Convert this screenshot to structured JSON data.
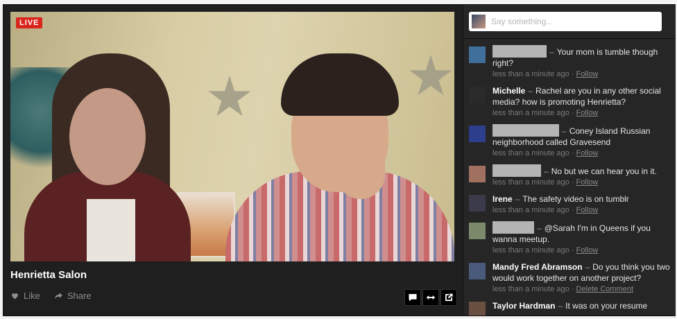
{
  "stream": {
    "live_label": "LIVE",
    "title": "Henrietta Salon",
    "like_label": "Like",
    "share_label": "Share"
  },
  "chat": {
    "placeholder": "Say something...",
    "comments": [
      {
        "name": "",
        "redacted": true,
        "text": "Your mom is tumble though right?",
        "time": "less than a minute ago",
        "action": "Follow",
        "avatar": "#3f6f9a"
      },
      {
        "name": "Michelle",
        "redacted": false,
        "text": "Rachel are you in any other social media? how is promoting Henrietta?",
        "time": "less than a minute ago",
        "action": "Follow",
        "avatar": "#2a2a2a"
      },
      {
        "name": "",
        "redacted": true,
        "text": "Coney Island Russian neighborhood called Gravesend",
        "time": "less than a minute ago",
        "action": "Follow",
        "avatar": "#2d3f8c"
      },
      {
        "name": "",
        "redacted": true,
        "text": "No but we can hear you in it.",
        "time": "less than a minute ago",
        "action": "Follow",
        "avatar": "#a07060"
      },
      {
        "name": "Irene",
        "redacted": false,
        "text": "The safety video is on tumblr",
        "time": "less than a minute ago",
        "action": "Follow",
        "avatar": "#3a3a4a"
      },
      {
        "name": "",
        "redacted": true,
        "text": "@Sarah I'm in Queens if you wanna meetup.",
        "time": "less than a minute ago",
        "action": "Follow",
        "avatar": "#7a8a6a"
      },
      {
        "name": "Mandy Fred Abramson",
        "redacted": false,
        "text": "Do you think you two would work together on another project?",
        "time": "less than a minute ago",
        "action": "Delete Comment",
        "avatar": "#4a5a7a"
      },
      {
        "name": "Taylor Hardman",
        "redacted": false,
        "text": "It was on your resume",
        "time": "",
        "action": "",
        "avatar": "#6a5040"
      }
    ]
  },
  "colors": {
    "live_red": "#d9261c",
    "panel_bg": "#1f1f1f",
    "sidebar_bg": "#262626"
  }
}
